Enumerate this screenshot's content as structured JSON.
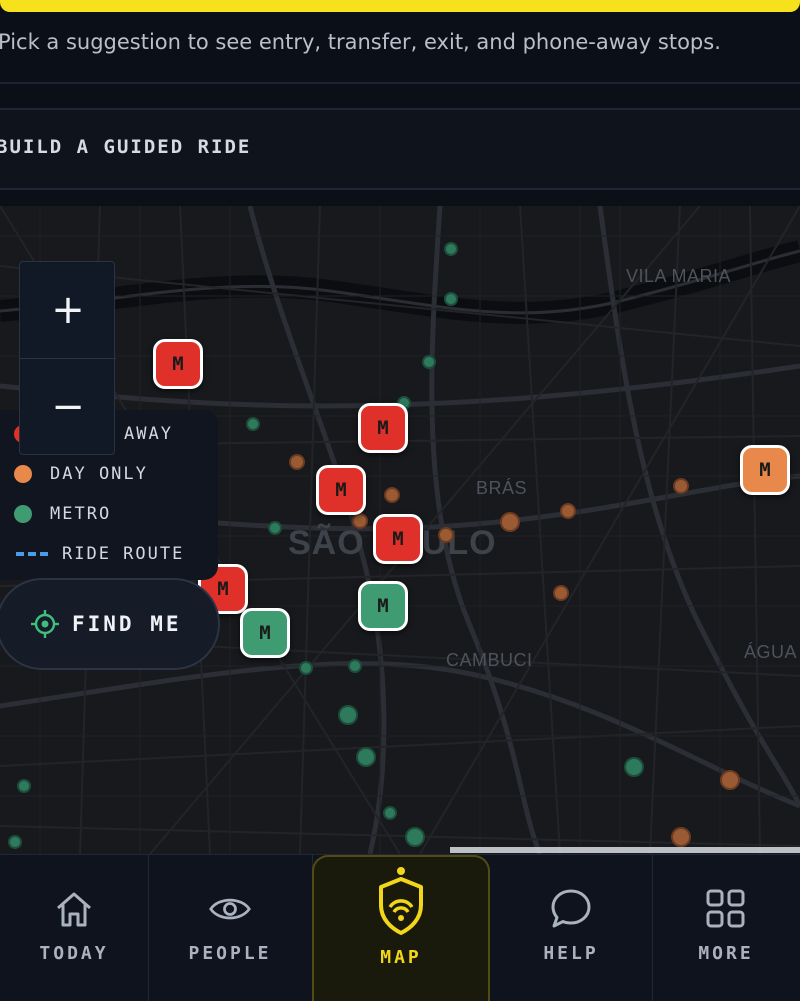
{
  "hint_text": "Pick a suggestion to see entry, transfer, exit, and phone-away stops.",
  "build_label": "BUILD A GUIDED RIDE",
  "map": {
    "districts": [
      "VILA MARIA",
      "BRÁS",
      "SÃO PAULO",
      "CAMBUCI",
      "ÁGUA"
    ],
    "zoom_in": "+",
    "zoom_out": "−",
    "pin_label": "M",
    "find_me": "FIND ME",
    "legend": [
      {
        "label": "PHONE-AWAY",
        "color": "#e0302a"
      },
      {
        "label": "DAY ONLY",
        "color": "#e8894b"
      },
      {
        "label": "METRO",
        "color": "#3f9b72"
      },
      {
        "label": "RIDE ROUTE",
        "color": "#4a9ce8"
      }
    ],
    "visible_legend_first": "AWAY"
  },
  "nav": {
    "items": [
      {
        "label": "TODAY",
        "icon": "home-icon"
      },
      {
        "label": "PEOPLE",
        "icon": "eye-icon"
      },
      {
        "label": "MAP",
        "icon": "shield-signal-icon",
        "active": true
      },
      {
        "label": "HELP",
        "icon": "chat-bubble-icon"
      },
      {
        "label": "MORE",
        "icon": "grid-icon"
      }
    ]
  },
  "colors": {
    "accent": "#f7e11c",
    "phone_away": "#e0302a",
    "day_only": "#e8894b",
    "metro": "#3f9b72"
  }
}
